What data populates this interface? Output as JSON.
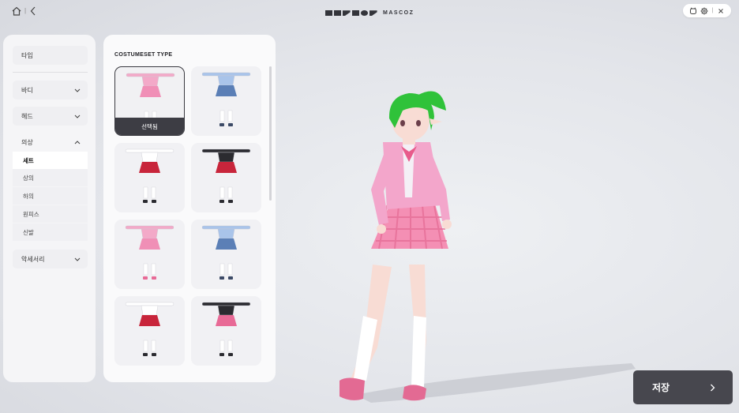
{
  "topbar": {
    "brand_text": "MASCOZ",
    "home_icon": "home-icon",
    "back_icon": "chevron-left-icon",
    "controls": [
      "mascot-icon",
      "gear-icon",
      "close-icon"
    ]
  },
  "sidebar": {
    "type_label": "타입",
    "body_label": "바디",
    "head_label": "헤드",
    "costume_label": "의상",
    "costume_items": [
      {
        "label": "세트",
        "active": true
      },
      {
        "label": "상의",
        "active": false
      },
      {
        "label": "하의",
        "active": false
      },
      {
        "label": "원피스",
        "active": false
      },
      {
        "label": "신발",
        "active": false
      }
    ],
    "accessory_label": "악세서리"
  },
  "costume_panel": {
    "title": "COSTUMESET TYPE",
    "selected_badge": "선택됨",
    "items": [
      {
        "name": "pink-uniform",
        "top": "#f3a9c8",
        "skirt": "#f08fb6",
        "shoes": "#e86a96"
      },
      {
        "name": "blue-uniform",
        "top": "#a9c4ea",
        "skirt": "#5b7fb6",
        "shoes": "#3c4a66"
      },
      {
        "name": "white-red-uniform",
        "top": "#ffffff",
        "skirt": "#c8253b",
        "shoes": "#2b2b30"
      },
      {
        "name": "black-red-uniform",
        "top": "#2b2b30",
        "skirt": "#c8253b",
        "shoes": "#2b2b30"
      },
      {
        "name": "pink-dress",
        "top": "#f3a9c8",
        "skirt": "#f08fb6",
        "shoes": "#e86a96"
      },
      {
        "name": "blue-dress",
        "top": "#a9c4ea",
        "skirt": "#5b7fb6",
        "shoes": "#3c4a66"
      },
      {
        "name": "red-dress",
        "top": "#ffffff",
        "skirt": "#c8253b",
        "shoes": "#2b2b30"
      },
      {
        "name": "black-pink-dress",
        "top": "#2b2b30",
        "skirt": "#e86a96",
        "shoes": "#2b2b30"
      }
    ]
  },
  "save_button": {
    "label": "저장"
  },
  "colors": {
    "accent_dark": "#47474e",
    "hair": "#2fc23a",
    "jacket": "#f3a6cb",
    "skirt": "#f48fb4"
  }
}
